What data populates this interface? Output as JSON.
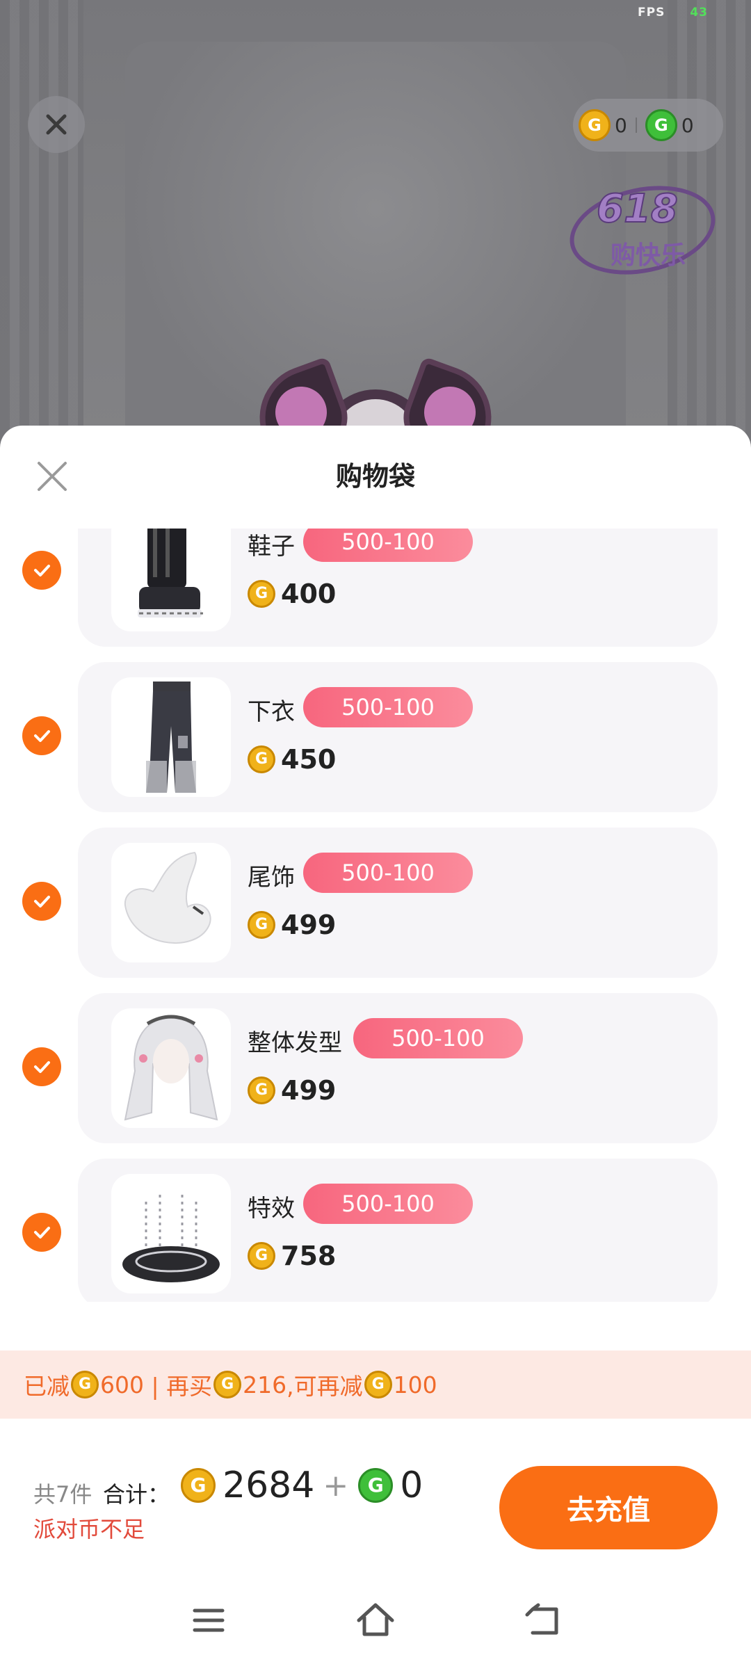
{
  "status": {
    "fps_label": "FPS",
    "fps_value": "43"
  },
  "topbar": {
    "gold_balance": "0",
    "green_balance": "0"
  },
  "event_badge": {
    "line1": "618",
    "line2": "购快乐"
  },
  "sheet": {
    "title": "购物袋"
  },
  "items": [
    {
      "name": "鞋子",
      "tag": "500-100",
      "price": "400",
      "checked": true,
      "icon": "shoes-thumbnail"
    },
    {
      "name": "下衣",
      "tag": "500-100",
      "price": "450",
      "checked": true,
      "icon": "pants-thumbnail"
    },
    {
      "name": "尾饰",
      "tag": "500-100",
      "price": "499",
      "checked": true,
      "icon": "tail-thumbnail"
    },
    {
      "name": "整体发型",
      "tag": "500-100",
      "price": "499",
      "checked": true,
      "icon": "hairstyle-thumbnail"
    },
    {
      "name": "特效",
      "tag": "500-100",
      "price": "758",
      "checked": true,
      "icon": "effect-thumbnail"
    }
  ],
  "discount": {
    "reduced_label": "已减",
    "reduced_amount": "600",
    "sep": " | 再买",
    "buy_more_amount": "216",
    "more_label": ",可再减",
    "more_amount": "100"
  },
  "footer": {
    "count_label": "共7件",
    "sum_label": "合计：",
    "gold_total": "2684",
    "plus": "+",
    "green_total": "0",
    "warning": "派对币不足",
    "recharge_label": "去充值"
  },
  "colors": {
    "accent": "#fa6e14",
    "tag_pink": "#f7667e",
    "warning": "#e24a3b",
    "coin_gold": "#f0b21a",
    "coin_green": "#3fbf3a"
  }
}
